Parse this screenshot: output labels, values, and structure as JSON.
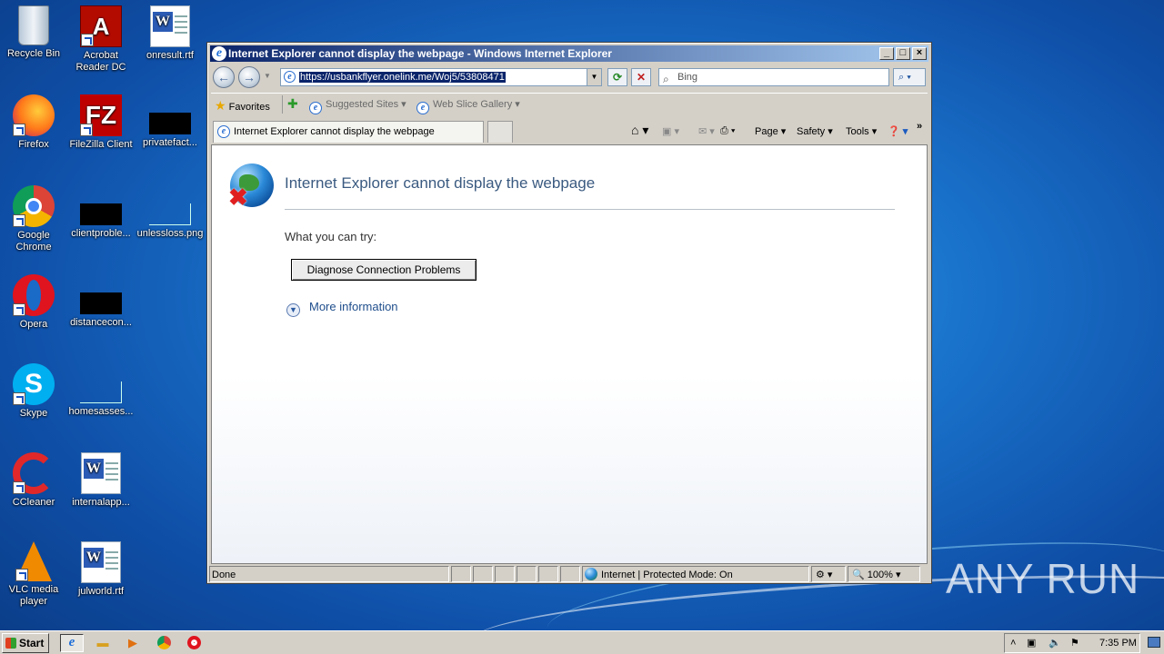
{
  "desktop": {
    "icons": [
      {
        "label": "Recycle Bin"
      },
      {
        "label": "Acrobat Reader DC"
      },
      {
        "label": "onresult.rtf"
      },
      {
        "label": "Firefox"
      },
      {
        "label": "FileZilla Client"
      },
      {
        "label": "privatefact..."
      },
      {
        "label": "Google Chrome"
      },
      {
        "label": "clientproble..."
      },
      {
        "label": "unlessloss.png"
      },
      {
        "label": "Opera"
      },
      {
        "label": "distancecon..."
      },
      {
        "label": "Skype"
      },
      {
        "label": "homesasses..."
      },
      {
        "label": "CCleaner"
      },
      {
        "label": "internalapp..."
      },
      {
        "label": "VLC media player"
      },
      {
        "label": "julworld.rtf"
      }
    ],
    "watermark": "ANY RUN"
  },
  "window": {
    "title": "Internet Explorer cannot display the webpage - Windows Internet Explorer",
    "address": "https://usbankflyer.onelink.me/Woj5/53808471",
    "search_placeholder": "Bing",
    "favorites": {
      "favorites_label": "Favorites",
      "suggested_sites": "Suggested Sites",
      "web_slice_gallery": "Web Slice Gallery"
    },
    "tab_title": "Internet Explorer cannot display the webpage",
    "commands": {
      "page": "Page",
      "safety": "Safety",
      "tools": "Tools"
    },
    "content": {
      "heading": "Internet Explorer cannot display the webpage",
      "what_you_can_try": "What you can try:",
      "diagnose_button": "Diagnose Connection Problems",
      "more_information": "More information"
    },
    "status": {
      "text": "Done",
      "zone": "Internet | Protected Mode: On",
      "zoom": "100%"
    }
  },
  "taskbar": {
    "start_label": "Start",
    "clock": "7:35 PM"
  }
}
